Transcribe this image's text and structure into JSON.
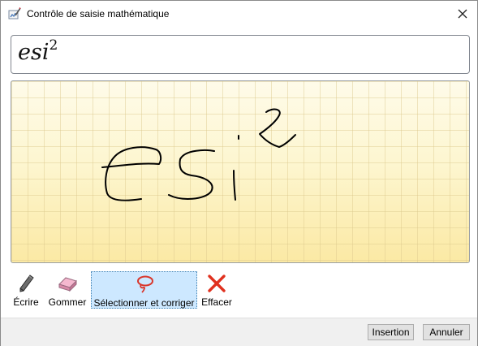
{
  "window": {
    "title": "Contrôle de saisie mathématique"
  },
  "preview": {
    "base": "esi",
    "exponent": "2"
  },
  "toolbar": {
    "tools": [
      {
        "label": "Écrire",
        "icon": "pen-icon"
      },
      {
        "label": "Gommer",
        "icon": "eraser-icon"
      },
      {
        "label": "Sélectionner et corriger",
        "icon": "lasso-icon",
        "selected": true
      },
      {
        "label": "Effacer",
        "icon": "clear-icon"
      }
    ]
  },
  "footer": {
    "insert_label": "Insertion",
    "cancel_label": "Annuler"
  },
  "colors": {
    "selected_tool_bg": "#cde8ff",
    "ink_panel_bg": "#fdf3c4",
    "ink": "#000000",
    "lasso": "#d9362b",
    "clear_x": "#e0301e"
  }
}
